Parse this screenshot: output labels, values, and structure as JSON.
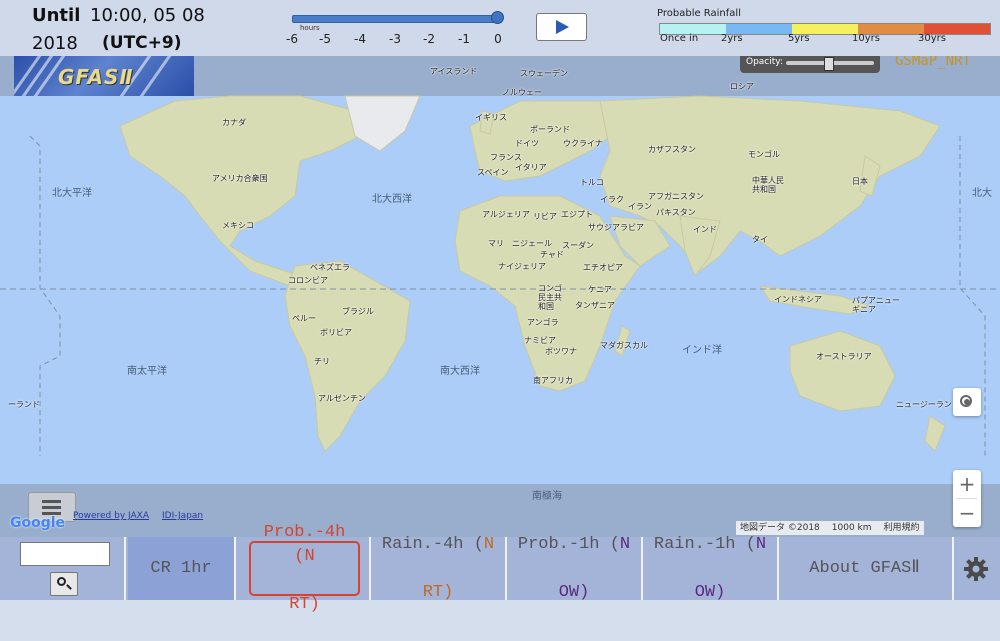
{
  "header": {
    "until_label": "Until",
    "time": "10:00, 05 08",
    "year": "2018",
    "timezone": "(UTC+9)"
  },
  "time_slider": {
    "unit_label": "hours",
    "ticks": [
      "-6",
      "-5",
      "-4",
      "-3",
      "-2",
      "-1",
      "0"
    ],
    "selected_fraction": 1.0
  },
  "play_button": {
    "icon": "play-icon"
  },
  "legend": {
    "title": "Probable Rainfall",
    "ticks": [
      "Once in",
      "2yrs",
      "5yrs",
      "10yrs",
      "30yrs"
    ],
    "colors": [
      "#b6f2f4",
      "#79b9f2",
      "#f4f060",
      "#e08c45",
      "#e05036"
    ]
  },
  "map": {
    "logo_text": "GFASⅡ",
    "opacity_label": "Opacity:",
    "opacity_value": 0.85,
    "product_badge": "GSMaP_NRT",
    "countries": [
      "アイスランド",
      "スウェーデン",
      "ノルウェー",
      "ロシア",
      "イギリス",
      "ポーランド",
      "ドイツ",
      "ウクライナ",
      "フランス",
      "カザフスタン",
      "モンゴル",
      "イタリア",
      "スペイン",
      "トルコ",
      "中華人民共和国",
      "日本",
      "カナダ",
      "アメリカ合衆国",
      "メキシコ",
      "アルジェリア",
      "リビア",
      "エジプト",
      "イラク",
      "イラン",
      "アフガニスタン",
      "パキスタン",
      "サウジアラビア",
      "インド",
      "タイ",
      "マリ",
      "ニジェール",
      "チャド",
      "スーダン",
      "ナイジェリア",
      "エチオピア",
      "ケニア",
      "コンゴ民主共和国",
      "タンザニア",
      "アンゴラ",
      "ナミビア",
      "ボツワナ",
      "南アフリカ",
      "マダガスカル",
      "ベネズエラ",
      "コロンビア",
      "ペルー",
      "ブラジル",
      "ボリビア",
      "チリ",
      "アルゼンチン",
      "インドネシア",
      "パプアニューギニア",
      "オーストラリア",
      "ニュージーランド",
      "ーランド"
    ],
    "oceans": [
      "北大平洋",
      "北大西洋",
      "南太平洋",
      "南大西洋",
      "インド洋",
      "南極海",
      "北大"
    ],
    "credits": {
      "google": "Google",
      "powered": "Powered by JAXA",
      "idi": "IDI-Japan"
    },
    "attribution": [
      "地図データ ©2018",
      "1000 km",
      "利用規約"
    ],
    "zoom_in": "+",
    "zoom_out": "−"
  },
  "bottom": {
    "search_placeholder": "",
    "tabs": [
      {
        "line1": "CR 1hr",
        "line2": ""
      },
      {
        "line1": "Prob.-4h (N",
        "line2": "RT)"
      },
      {
        "line1": "Rain.-4h (",
        "acc1": "N",
        "line2": "RT)"
      },
      {
        "line1": "Prob.-1h (",
        "acc1": "N",
        "line2": "OW)"
      },
      {
        "line1": "Rain.-1h (",
        "acc1": "N",
        "line2": "OW)"
      },
      {
        "line1": "About GFASⅡ",
        "line2": ""
      }
    ]
  }
}
